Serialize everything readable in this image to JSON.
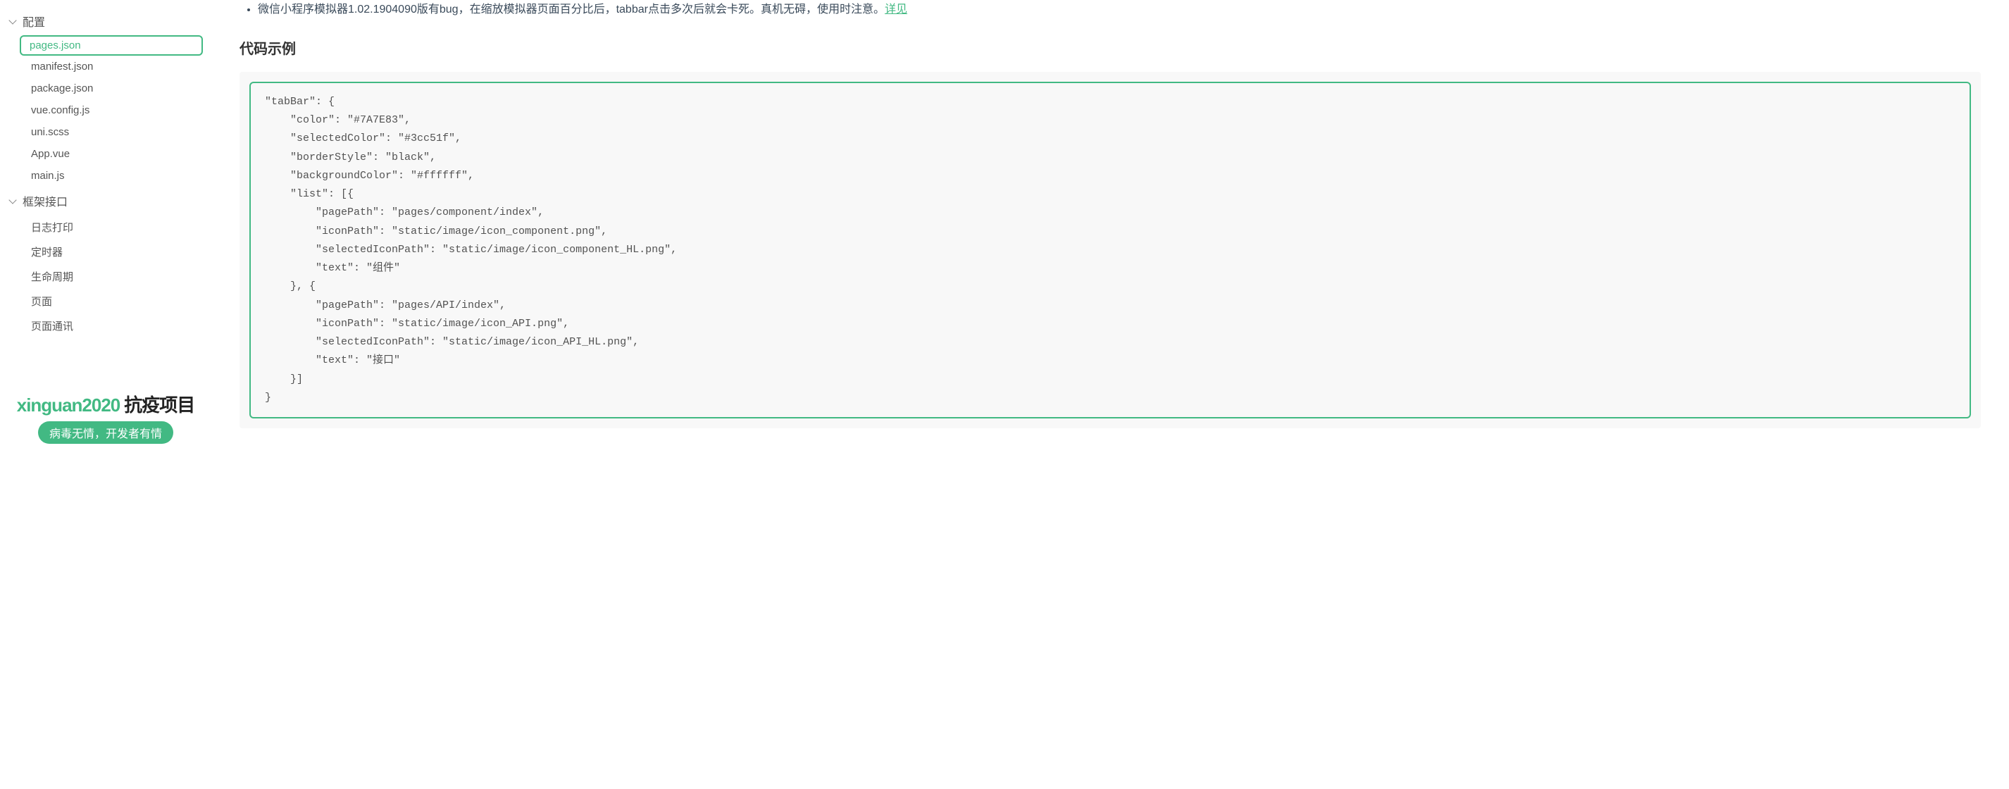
{
  "sidebar": {
    "section1": {
      "title": "配置",
      "items": [
        {
          "label": "pages.json",
          "active": true
        },
        {
          "label": "manifest.json"
        },
        {
          "label": "package.json"
        },
        {
          "label": "vue.config.js"
        },
        {
          "label": "uni.scss"
        },
        {
          "label": "App.vue"
        },
        {
          "label": "main.js"
        }
      ]
    },
    "section2": {
      "title": "框架接口",
      "items": [
        {
          "label": "日志打印"
        },
        {
          "label": "定时器"
        },
        {
          "label": "生命周期"
        },
        {
          "label": "页面"
        },
        {
          "label": "页面通讯"
        }
      ]
    }
  },
  "promo": {
    "brand": "xinguan2020",
    "rest": "抗疫项目",
    "badge": "病毒无情，开发者有情"
  },
  "content": {
    "note": "微信小程序模拟器1.02.1904090版有bug，在缩放模拟器页面百分比后，tabbar点击多次后就会卡死。真机无碍，使用时注意。",
    "note_link": "详见",
    "heading": "代码示例",
    "code": "\"tabBar\": {\n    \"color\": \"#7A7E83\",\n    \"selectedColor\": \"#3cc51f\",\n    \"borderStyle\": \"black\",\n    \"backgroundColor\": \"#ffffff\",\n    \"list\": [{\n        \"pagePath\": \"pages/component/index\",\n        \"iconPath\": \"static/image/icon_component.png\",\n        \"selectedIconPath\": \"static/image/icon_component_HL.png\",\n        \"text\": \"组件\"\n    }, {\n        \"pagePath\": \"pages/API/index\",\n        \"iconPath\": \"static/image/icon_API.png\",\n        \"selectedIconPath\": \"static/image/icon_API_HL.png\",\n        \"text\": \"接口\"\n    }]\n}"
  }
}
